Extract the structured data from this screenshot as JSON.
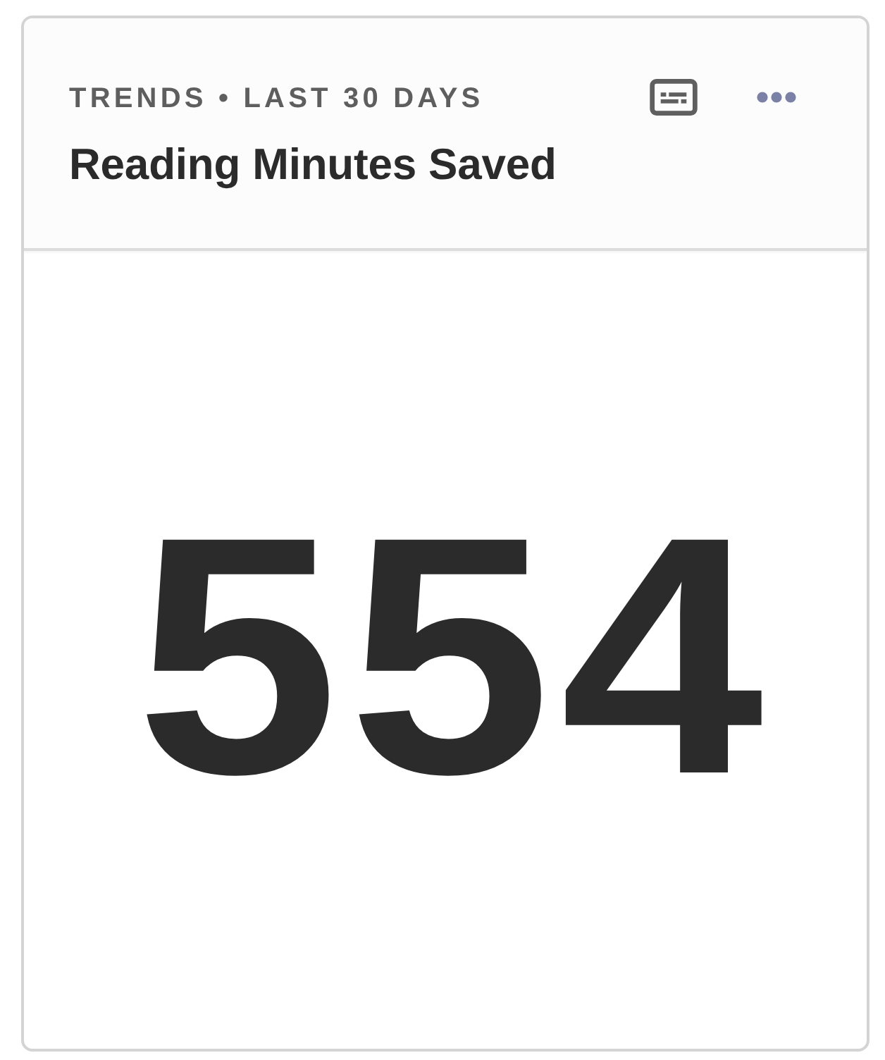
{
  "card": {
    "eyebrow": "TRENDS • LAST 30 DAYS",
    "title": "Reading Minutes Saved",
    "value": "554"
  }
}
